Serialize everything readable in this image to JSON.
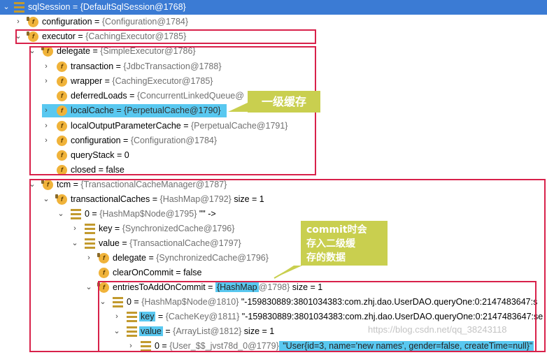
{
  "rows": [
    {
      "label": "sqlSession",
      "value": "{DefaultSqlSession@1768}",
      "suffix": ""
    },
    {
      "label": "configuration",
      "value": "{Configuration@1784}",
      "suffix": ""
    },
    {
      "label": "executor",
      "value": "{CachingExecutor@1785}",
      "suffix": ""
    },
    {
      "label": "delegate",
      "value": "{SimpleExecutor@1786}",
      "suffix": ""
    },
    {
      "label": "transaction",
      "value": "{JdbcTransaction@1788}",
      "suffix": ""
    },
    {
      "label": "wrapper",
      "value": "{CachingExecutor@1785}",
      "suffix": ""
    },
    {
      "label": "deferredLoads",
      "value": "{ConcurrentLinkedQueue@",
      "suffix": ""
    },
    {
      "label": "localCache",
      "value": "{PerpetualCache@1790}",
      "suffix": ""
    },
    {
      "label": "localOutputParameterCache",
      "value": "{PerpetualCache@1791}",
      "suffix": ""
    },
    {
      "label": "configuration",
      "value": "{Configuration@1784}",
      "suffix": ""
    },
    {
      "label": "queryStack",
      "value": "0",
      "suffix": ""
    },
    {
      "label": "closed",
      "value": "false",
      "suffix": ""
    },
    {
      "label": "tcm",
      "value": "{TransactionalCacheManager@1787}",
      "suffix": ""
    },
    {
      "label": "transactionalCaches",
      "value": "{HashMap@1792}",
      "suffix": " size = 1"
    },
    {
      "label": "0",
      "value": "{HashMap$Node@1795}",
      "suffix": " \"\" ->"
    },
    {
      "label": "key",
      "value": "{SynchronizedCache@1796}",
      "suffix": ""
    },
    {
      "label": "value",
      "value": "{TransactionalCache@1797}",
      "suffix": ""
    },
    {
      "label": "delegate",
      "value": "{SynchronizedCache@1796}",
      "suffix": ""
    },
    {
      "label": "clearOnCommit",
      "value": "false",
      "suffix": ""
    },
    {
      "label": "entriesToAddOnCommit",
      "value_hl": "{HashMap",
      "value": "@1798}",
      "suffix": " size = 1"
    },
    {
      "label": "0",
      "value": "{HashMap$Node@1810}",
      "suffix": " \"-159830889:3801034383:com.zhj.dao.UserDAO.queryOne:0:2147483647:s"
    },
    {
      "label": "key",
      "value": "{CacheKey@1811}",
      "suffix": " \"-159830889:3801034383:com.zhj.dao.UserDAO.queryOne:0:2147483647:se"
    },
    {
      "label": "value",
      "value": "{ArrayList@1812}",
      "suffix": " size = 1"
    },
    {
      "label": "0",
      "value": "{User_$$_jvst78d_0@1779}",
      "suffix": " \"User{id=3, name='new names', gender=false, createTime=null}\""
    }
  ],
  "callouts": {
    "first_level": "一级缓存",
    "second_level": [
      "commit时会",
      "存入二级缓",
      "存的数据"
    ]
  },
  "watermark": "https://blog.csdn.net/qq_38243118",
  "colors": {
    "selection": "#3b7bd4",
    "highlight": "#59c8f0",
    "annotation_box": "#d8214a",
    "callout": "#c9cf4f"
  }
}
